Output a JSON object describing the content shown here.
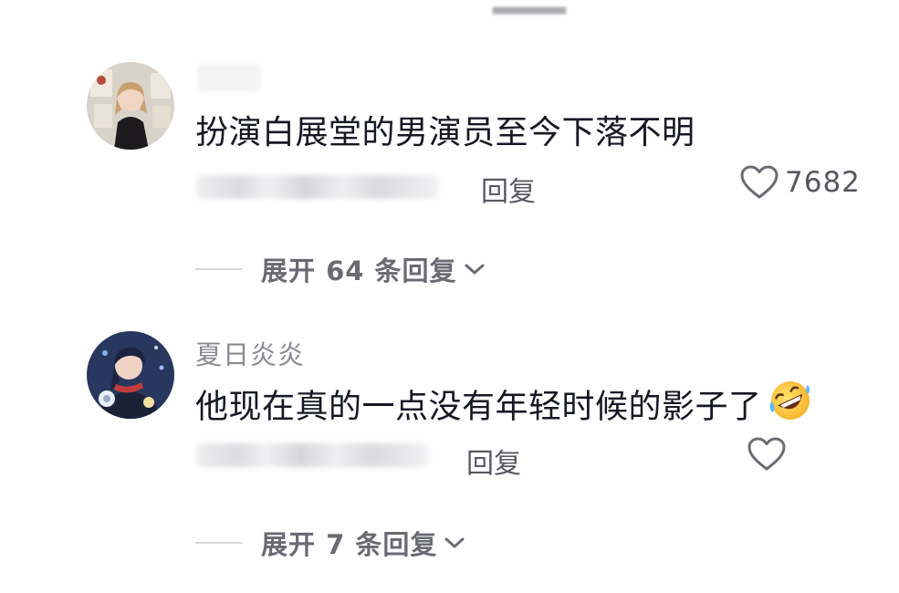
{
  "comments": [
    {
      "username": "",
      "text": "扮演白展堂的男演员至今下落不明",
      "reply_label": "回复",
      "like_count": "7682",
      "expand_label": "展开 64 条回复"
    },
    {
      "username": "夏日炎炎",
      "text": "他现在真的一点没有年轻时候的影子了",
      "reply_label": "回复",
      "like_count": "",
      "expand_label": "展开 7 条回复"
    }
  ],
  "colors": {
    "text_primary": "#161823",
    "text_secondary": "#57585f",
    "username": "#8a8b91",
    "expand_label": "#6a6b72"
  },
  "icons": [
    "heart-icon",
    "chevron-down-icon",
    "rolling-laughing-emoji"
  ]
}
